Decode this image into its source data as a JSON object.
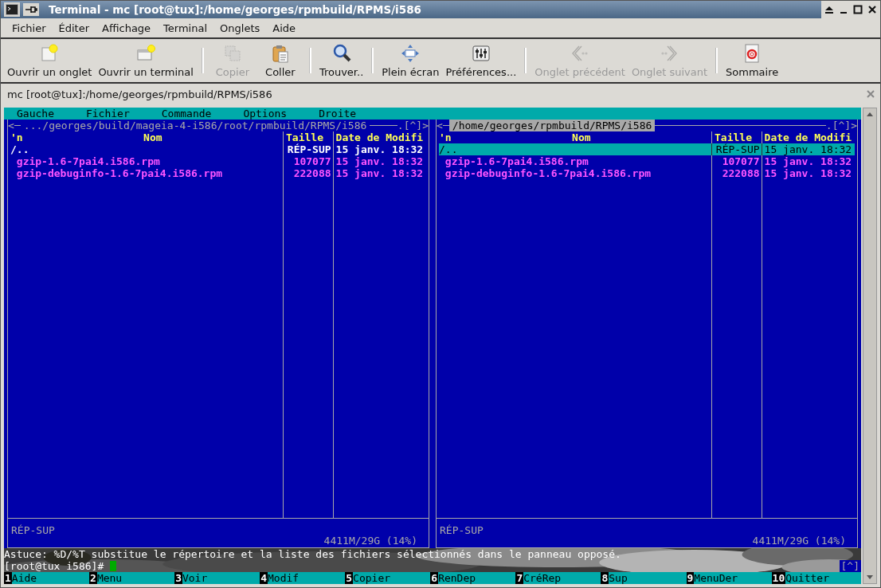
{
  "window": {
    "title": "Terminal - mc [root@tux]:/home/georges/rpmbuild/RPMS/i586"
  },
  "menu": [
    "Fichier",
    "Éditer",
    "Affichage",
    "Terminal",
    "Onglets",
    "Aide"
  ],
  "toolbar": [
    {
      "kind": "button",
      "label": "Ouvrir un onglet",
      "disabled": false
    },
    {
      "kind": "button",
      "label": "Ouvrir un terminal",
      "disabled": false
    },
    {
      "kind": "separator"
    },
    {
      "kind": "button",
      "label": "Copier",
      "disabled": true
    },
    {
      "kind": "button",
      "label": "Coller",
      "disabled": false
    },
    {
      "kind": "separator"
    },
    {
      "kind": "button",
      "label": "Trouver..",
      "disabled": false
    },
    {
      "kind": "separator"
    },
    {
      "kind": "button",
      "label": "Plein écran",
      "disabled": false
    },
    {
      "kind": "button",
      "label": "Préférences...",
      "disabled": false
    },
    {
      "kind": "separator"
    },
    {
      "kind": "button",
      "label": "Onglet précédent",
      "disabled": true
    },
    {
      "kind": "button",
      "label": "Onglet suivant",
      "disabled": true
    },
    {
      "kind": "separator"
    },
    {
      "kind": "button",
      "label": "Sommaire",
      "disabled": false
    }
  ],
  "tab": {
    "label": "mc [root@tux]:/home/georges/rpmbuild/RPMS/i586"
  },
  "mc_menu": [
    "Gauche",
    "Fichier",
    "Commande",
    "Options",
    "Droite"
  ],
  "panels": [
    {
      "selected": false,
      "left_marker": "<",
      "path": ".../georges/build/mageia-4-i586/root/rpmbuild/RPMS/i586",
      "right_marker": ".[^]>",
      "columns": [
        "'n",
        "Nom",
        "Taille",
        "Date de Modifi"
      ],
      "rows": [
        {
          "kind": "dir",
          "name": "/..",
          "size": "RÉP-SUP",
          "date": "15 janv. 18:32",
          "selected": false
        },
        {
          "kind": "file",
          "name": "gzip-1.6-7pai4.i586.rpm",
          "size": "107077",
          "date": "15 janv. 18:32",
          "selected": false
        },
        {
          "kind": "file",
          "name": "gzip-debuginfo-1.6-7pai4.i586.rpm",
          "size": "222088",
          "date": "15 janv. 18:32",
          "selected": false
        }
      ],
      "status": "RÉP-SUP",
      "footer": "4411M/29G (14%)"
    },
    {
      "selected": true,
      "left_marker": "<",
      "path": "/home/georges/rpmbuild/RPMS/i586",
      "right_marker": ".[^]>",
      "columns": [
        "'n",
        "Nom",
        "Taille",
        "Date de Modifi"
      ],
      "rows": [
        {
          "kind": "dir",
          "name": "/..",
          "size": "RÉP-SUP",
          "date": "15 janv. 18:32",
          "selected": true
        },
        {
          "kind": "file",
          "name": "gzip-1.6-7pai4.i586.rpm",
          "size": "107077",
          "date": "15 janv. 18:32",
          "selected": false
        },
        {
          "kind": "file",
          "name": "gzip-debuginfo-1.6-7pai4.i586.rpm",
          "size": "222088",
          "date": "15 janv. 18:32",
          "selected": false
        }
      ],
      "status": "RÉP-SUP",
      "footer": "4411M/29G (14%)"
    }
  ],
  "hint": "Astuce: %D/%T substitue le répertoire et la liste des fichiers sélectionnés dans le panneau opposé.",
  "prompt": "[root@tux i586]#",
  "history_button": "[^]",
  "function_keys": [
    {
      "key": "1",
      "label": "Aide"
    },
    {
      "key": "2",
      "label": "Menu"
    },
    {
      "key": "3",
      "label": "Voir"
    },
    {
      "key": "4",
      "label": "Modif"
    },
    {
      "key": "5",
      "label": "Copier"
    },
    {
      "key": "6",
      "label": "RenDep"
    },
    {
      "key": "7",
      "label": "CréRep"
    },
    {
      "key": "8",
      "label": "Sup"
    },
    {
      "key": "9",
      "label": "MenuDer"
    },
    {
      "key": "10",
      "label": "Quitter"
    }
  ]
}
